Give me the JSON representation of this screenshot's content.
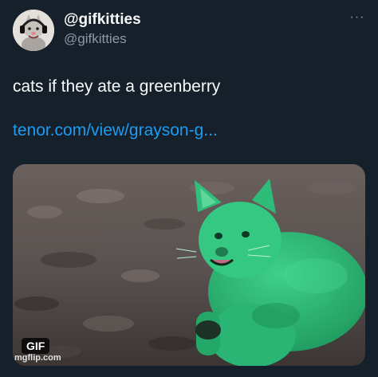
{
  "author": {
    "display_name": "@gifkitties",
    "handle": "@gifkitties",
    "avatar_icon": "cat-with-headphones-avatar"
  },
  "menu": {
    "more_label": "···",
    "icon": "more-horizontal-icon"
  },
  "tweet": {
    "text": "cats if they ate a greenberry",
    "link_text": "tenor.com/view/grayson-g..."
  },
  "media": {
    "badge": "GIF",
    "watermark": "mgflip.com",
    "subject": "green-cat-gif"
  },
  "colors": {
    "background": "#15202b",
    "text_primary": "#f7f9f9",
    "text_secondary": "#8b98a5",
    "link": "#1d9bf0",
    "cat_green": "#2fbf7a"
  }
}
